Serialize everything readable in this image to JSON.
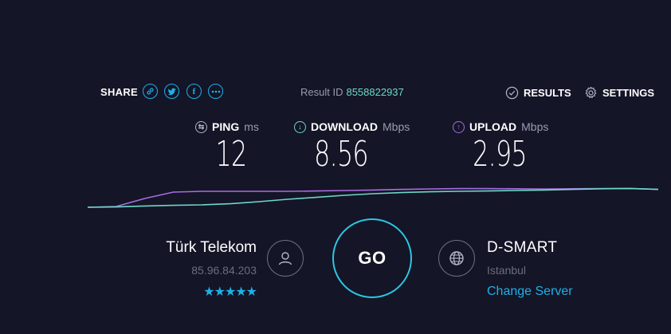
{
  "header": {
    "share_label": "SHARE",
    "share_icons": [
      "link-icon",
      "twitter-icon",
      "facebook-icon",
      "more-icon"
    ],
    "result_label": "Result ID",
    "result_id": "8558822937",
    "results_label": "RESULTS",
    "settings_label": "SETTINGS"
  },
  "metrics": {
    "ping": {
      "label": "PING",
      "unit": "ms",
      "value": "12"
    },
    "download": {
      "label": "DOWNLOAD",
      "unit": "Mbps",
      "value": "8.56"
    },
    "upload": {
      "label": "UPLOAD",
      "unit": "Mbps",
      "value": "2.95"
    }
  },
  "isp": {
    "name": "Türk Telekom",
    "ip": "85.96.84.203",
    "stars": "★★★★★"
  },
  "go_label": "GO",
  "server": {
    "name": "D-SMART",
    "city": "Istanbul",
    "change_label": "Change Server"
  },
  "colors": {
    "background": "#141527",
    "accent": "#1fb0e8",
    "download": "#6dd7c7",
    "upload": "#a96ce0",
    "go_ring": "#2bc8e2"
  },
  "chart_data": {
    "type": "line",
    "series": [
      {
        "values": [
          0,
          0.05,
          0.55,
          0.95,
          1.0,
          1.0,
          1.0,
          1.0,
          1.02,
          1.05,
          1.08,
          1.12,
          1.15,
          1.17,
          1.17,
          1.16,
          1.14,
          1.16,
          1.17,
          1.18,
          1.12
        ]
      },
      {
        "values": [
          0,
          0.02,
          0.08,
          0.12,
          0.15,
          0.22,
          0.35,
          0.5,
          0.62,
          0.75,
          0.85,
          0.92,
          0.97,
          1.0,
          1.02,
          1.05,
          1.08,
          1.12,
          1.16,
          1.18,
          1.12
        ]
      }
    ]
  }
}
